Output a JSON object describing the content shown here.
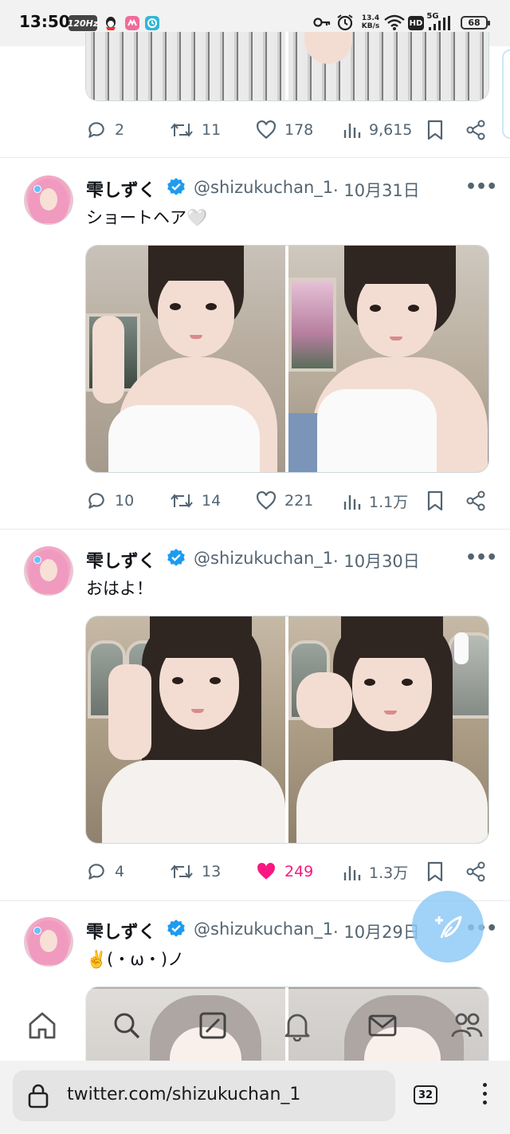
{
  "status_bar": {
    "time": "13:50",
    "refresh_rate": "120Hz",
    "net_speed_value": "13.4",
    "net_speed_unit": "KB/s",
    "hd_badge": "HD",
    "signal_label": "5G",
    "battery": "68"
  },
  "tweets": [
    {
      "actions": {
        "replies": "2",
        "retweets": "11",
        "likes": "178",
        "views": "9,615"
      }
    },
    {
      "name": "雫しずく",
      "handle": "@shizukuchan_1",
      "date": "· 10月31日",
      "text": "ショートヘア🤍",
      "actions": {
        "replies": "10",
        "retweets": "14",
        "likes": "221",
        "views": "1.1万"
      }
    },
    {
      "name": "雫しずく",
      "handle": "@shizukuchan_1",
      "date": "· 10月30日",
      "text": "おはよ！",
      "actions": {
        "replies": "4",
        "retweets": "13",
        "likes": "249",
        "views": "1.3万",
        "liked": true
      }
    },
    {
      "name": "雫しずく",
      "handle": "@shizukuchan_1",
      "date": "· 10月29日",
      "text": "✌️(・ω・)ノ"
    }
  ],
  "browser": {
    "url": "twitter.com/shizukuchan_1",
    "tab_count": "32"
  },
  "colors": {
    "like_active": "#f91880",
    "icon_gray": "#536471",
    "verified_blue": "#1d9bf0",
    "fab_blue": "#8cc8f5"
  },
  "icons": {
    "tab_bar": [
      "home-icon",
      "search-icon",
      "grok-icon",
      "notifications-icon",
      "messages-icon",
      "communities-icon"
    ],
    "actions": [
      "reply-icon",
      "retweet-icon",
      "like-icon",
      "views-icon",
      "bookmark-icon",
      "share-icon"
    ]
  }
}
